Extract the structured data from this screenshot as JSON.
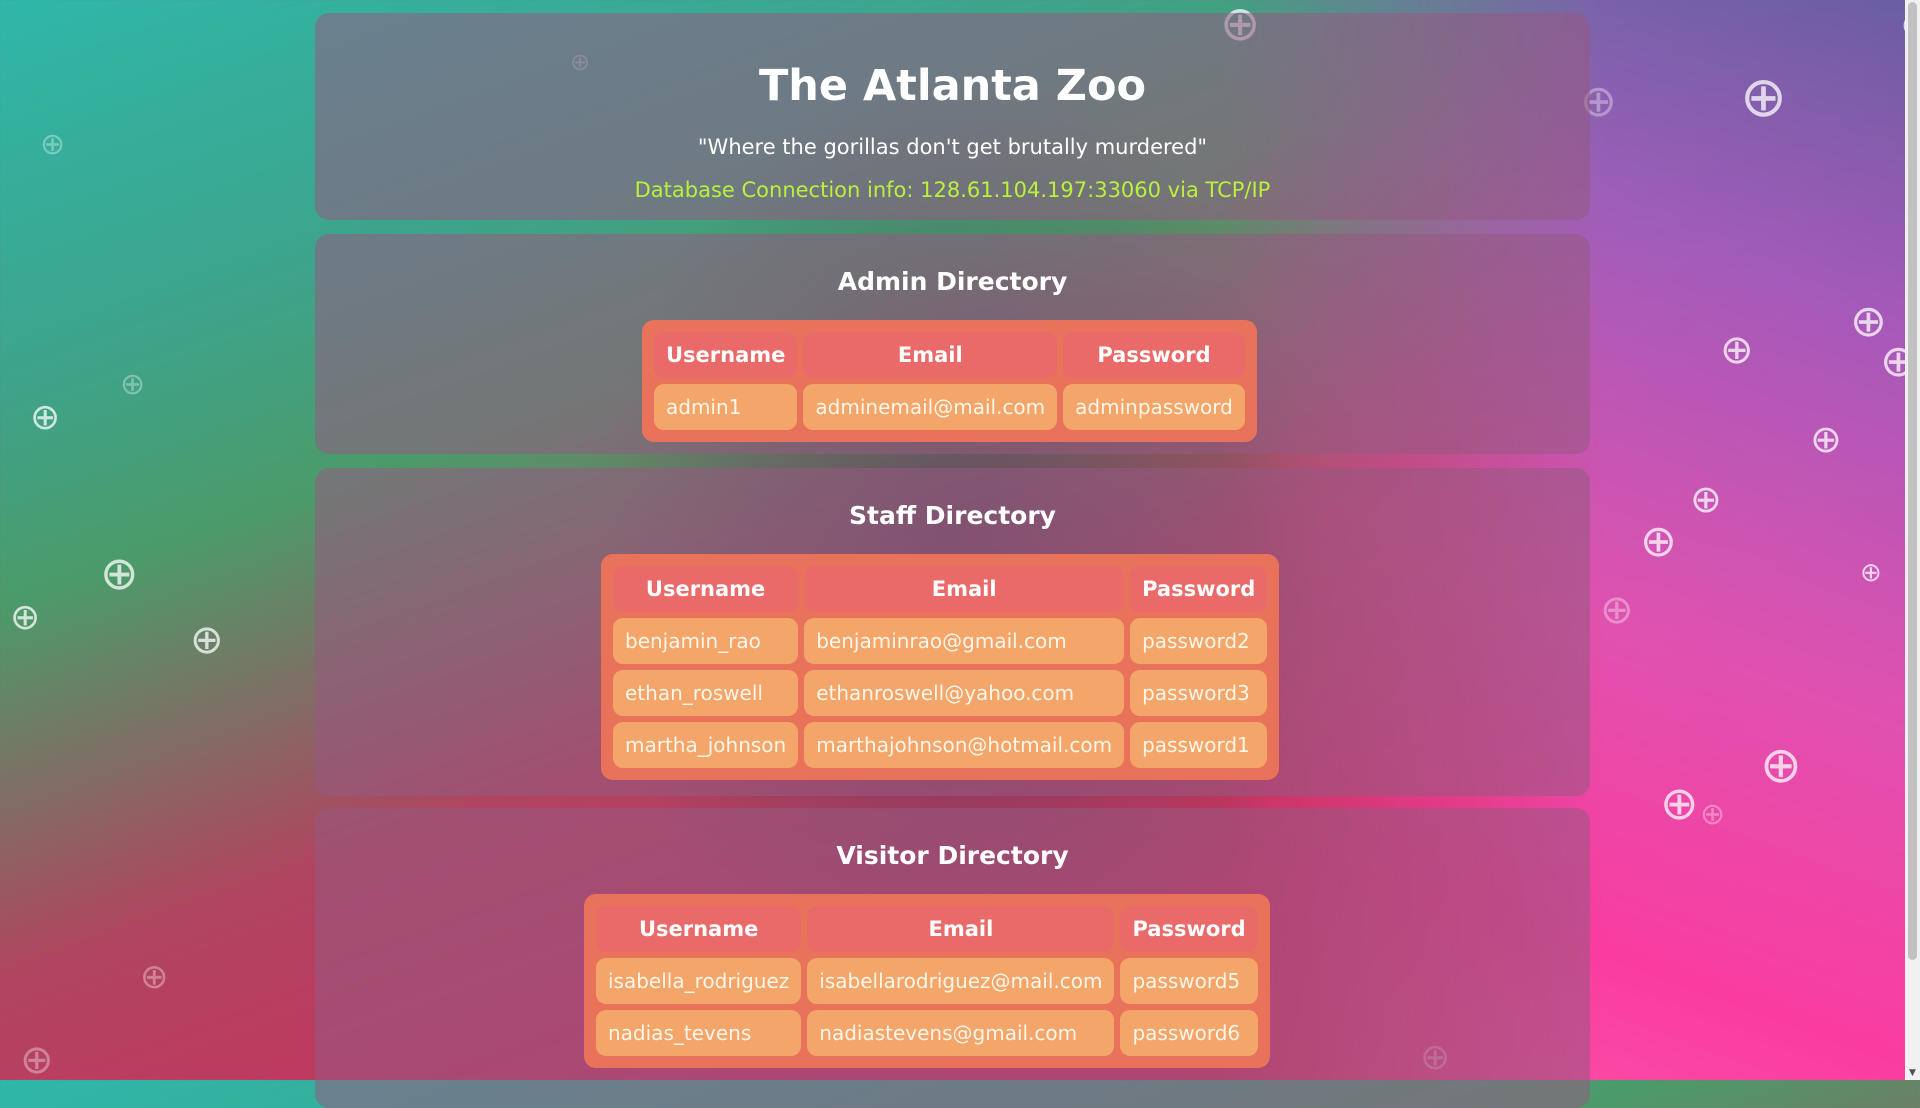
{
  "site": {
    "title": "The Atlanta Zoo",
    "slogan": "\"Where the gorillas don't get brutally murdered\"",
    "db_info": "Database Connection info: 128.61.104.197:33060 via TCP/IP"
  },
  "admin": {
    "title": "Admin Directory",
    "headers": [
      "Username",
      "Email",
      "Password"
    ],
    "rows": [
      [
        "admin1",
        "adminemail@mail.com",
        "adminpassword"
      ]
    ]
  },
  "staff": {
    "title": "Staff Directory",
    "headers": [
      "Username",
      "Email",
      "Password"
    ],
    "rows": [
      [
        "benjamin_rao",
        "benjaminrao@gmail.com",
        "password2"
      ],
      [
        "ethan_roswell",
        "ethanroswell@yahoo.com",
        "password3"
      ],
      [
        "martha_johnson",
        "marthajohnson@hotmail.com",
        "password1"
      ]
    ]
  },
  "visitor": {
    "title": "Visitor Directory",
    "headers": [
      "Username",
      "Email",
      "Password"
    ],
    "rows": [
      [
        "isabella_rodriguez",
        "isabellarodriguez@mail.com",
        "password5"
      ],
      [
        "nadias_tevens",
        "nadiastevens@gmail.com",
        "password6"
      ]
    ]
  },
  "background": {
    "decor_icon": "crosshair-circle-icon"
  }
}
